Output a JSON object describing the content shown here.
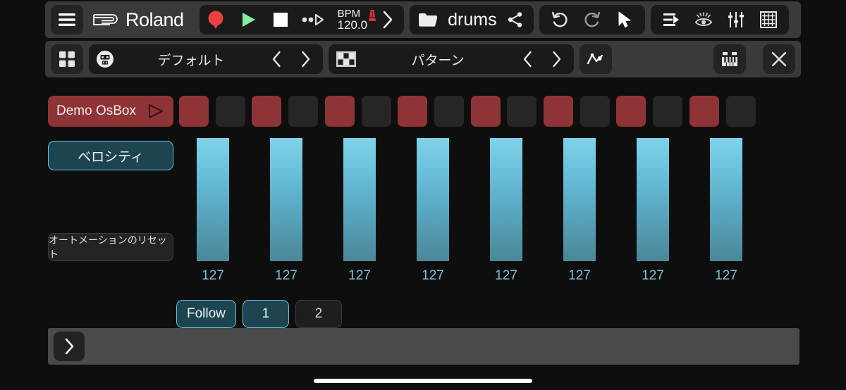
{
  "brand": {
    "name": "Roland",
    "logo_icon": "roland-logo-icon"
  },
  "toolbar_top": {
    "menu_icon": "hamburger-menu-icon",
    "transport": {
      "record_icon": "record-icon",
      "play_icon": "play-icon",
      "stop_icon": "stop-icon",
      "step_play_icon": "step-play-icon"
    },
    "tempo": {
      "label": "BPM",
      "value": "120.0",
      "metronome_icon": "metronome-icon",
      "expand_icon": "chevron-right-icon"
    },
    "project": {
      "folder_icon": "folder-icon",
      "name": "drums",
      "share_icon": "share-icon"
    },
    "history": {
      "undo_icon": "undo-icon",
      "redo_icon": "redo-icon",
      "select_icon": "cursor-arrow-icon"
    },
    "views": {
      "arrange_icon": "arrange-icon",
      "eye_icon": "eye-icon",
      "mixer_icon": "mixer-faders-icon",
      "grid_icon": "grid-icon"
    }
  },
  "toolbar_sub": {
    "apps_icon": "apps-grid-icon",
    "kit": {
      "instrument_icon": "drum-machine-icon",
      "name": "デフォルト",
      "prev_icon": "chevron-left-icon",
      "next_icon": "chevron-right-icon"
    },
    "pattern": {
      "pattern_icon": "pattern-grid-icon",
      "name": "パターン",
      "prev_icon": "chevron-left-icon",
      "next_icon": "chevron-right-icon"
    },
    "automation_icon": "automation-curve-icon",
    "keyboard_icon": "keyboard-icon",
    "close_icon": "close-icon"
  },
  "track": {
    "name": "Demo OsBox",
    "preview_icon": "play-triangle-icon",
    "active_color": "#8e3437",
    "inactive_color": "#262626",
    "steps": [
      true,
      false,
      true,
      false,
      true,
      false,
      true,
      false,
      true,
      false,
      true,
      false,
      true,
      false,
      true,
      false
    ]
  },
  "controls": {
    "velocity_label": "ベロシティ",
    "reset_automation_label": "オートメーションのリセット",
    "accent_color": "#62c6e0",
    "accent_fill": "#1d4450"
  },
  "velocity": {
    "values": [
      127,
      127,
      127,
      127,
      127,
      127,
      127,
      127
    ],
    "max": 127,
    "bar_top_color": "#80d2e8",
    "bar_bottom_color": "#4b8798",
    "label_color": "#7fc4d8"
  },
  "footer": {
    "follow_label": "Follow",
    "follow_active": true,
    "pages": [
      {
        "label": "1",
        "active": true
      },
      {
        "label": "2",
        "active": false
      }
    ]
  },
  "bottom_bar": {
    "expand_icon": "chevron-right-icon"
  }
}
